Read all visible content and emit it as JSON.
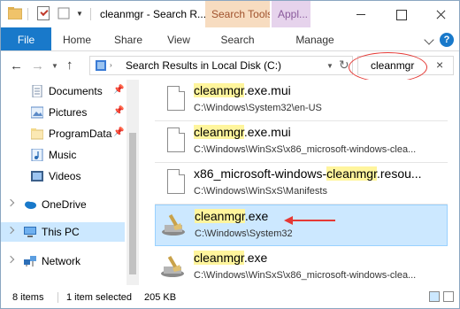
{
  "window": {
    "title": "cleanmgr - Search R...",
    "context_tabs": [
      "Search Tools",
      "Appl..."
    ]
  },
  "ribbon": {
    "tabs": [
      "File",
      "Home",
      "Share",
      "View",
      "Search",
      "Manage"
    ]
  },
  "address": {
    "path": "Search Results in Local Disk (C:)",
    "search_value": "cleanmgr"
  },
  "nav_pane": {
    "quick_access": [
      {
        "label": "Documents",
        "pinned": true,
        "icon": "documents-icon"
      },
      {
        "label": "Pictures",
        "pinned": true,
        "icon": "pictures-icon"
      },
      {
        "label": "ProgramData",
        "pinned": true,
        "icon": "folder-icon"
      },
      {
        "label": "Music",
        "pinned": false,
        "icon": "music-icon"
      },
      {
        "label": "Videos",
        "pinned": false,
        "icon": "videos-icon"
      }
    ],
    "onedrive": "OneDrive",
    "this_pc": "This PC",
    "network": "Network"
  },
  "results": [
    {
      "highlight": "cleanmgr",
      "pre": "",
      "post": ".exe.mui",
      "path": "C:\\Windows\\System32\\en-US",
      "icon": "file-icon",
      "selected": false
    },
    {
      "highlight": "cleanmgr",
      "pre": "",
      "post": ".exe.mui",
      "path": "C:\\Windows\\WinSxS\\x86_microsoft-windows-clea...",
      "icon": "file-icon",
      "selected": false
    },
    {
      "highlight": "cleanmgr",
      "pre": "x86_microsoft-windows-",
      "post": ".resou...",
      "path": "C:\\Windows\\WinSxS\\Manifests",
      "icon": "file-icon",
      "selected": false
    },
    {
      "highlight": "cleanmgr",
      "pre": "",
      "post": ".exe",
      "path": "C:\\Windows\\System32",
      "icon": "cleanmgr-exe-icon",
      "selected": true
    },
    {
      "highlight": "cleanmgr",
      "pre": "",
      "post": ".exe",
      "path": "C:\\Windows\\WinSxS\\x86_microsoft-windows-clea...",
      "icon": "cleanmgr-exe-icon",
      "selected": false
    }
  ],
  "status": {
    "count": "8 items",
    "selected": "1 item selected",
    "size": "205 KB"
  },
  "colors": {
    "accent": "#1979ca",
    "selection": "#cce8ff",
    "highlight": "#fff59d",
    "annotation": "#e53935"
  }
}
